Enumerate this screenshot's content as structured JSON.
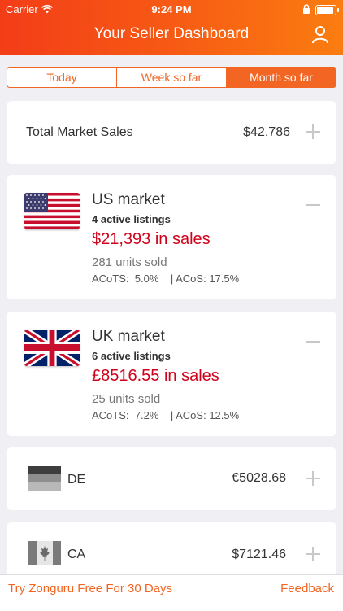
{
  "status_bar": {
    "carrier": "Carrier",
    "time": "9:24 PM",
    "battery_level": 0.9
  },
  "header": {
    "title": "Your Seller Dashboard",
    "user_icon": "user-icon"
  },
  "segments": [
    {
      "label": "Today",
      "active": false
    },
    {
      "label": "Week so far",
      "active": false
    },
    {
      "label": "Month so far",
      "active": true
    }
  ],
  "total": {
    "label": "Total Market Sales",
    "value": "$42,786"
  },
  "markets": [
    {
      "name": "US market",
      "listings": "4 active listings",
      "sales": "$21,393 in sales",
      "units": "281 units sold",
      "acots_label": "ACoTS:",
      "acots_value": "5.0%",
      "acos_label": "| ACoS:",
      "acos_value": "17.5%",
      "flag_icon": "us-flag-icon"
    },
    {
      "name": "UK market",
      "listings": "6 active listings",
      "sales": "£8516.55 in sales",
      "units": "25 units sold",
      "acots_label": "ACoTS:",
      "acots_value": "7.2%",
      "acos_label": "| ACoS:",
      "acos_value": "12.5%",
      "flag_icon": "uk-flag-icon"
    }
  ],
  "small_markets": [
    {
      "name": "DE",
      "value": "€5028.68",
      "flag_icon": "de-flag-icon"
    },
    {
      "name": "CA",
      "value": "$7121.46",
      "flag_icon": "ca-flag-icon"
    }
  ],
  "footer": {
    "try_label": "Try Zonguru Free For 30 Days",
    "feedback_label": "Feedback"
  },
  "colors": {
    "accent": "#f26522",
    "sales_red": "#d0021b",
    "background": "#efeff4"
  }
}
